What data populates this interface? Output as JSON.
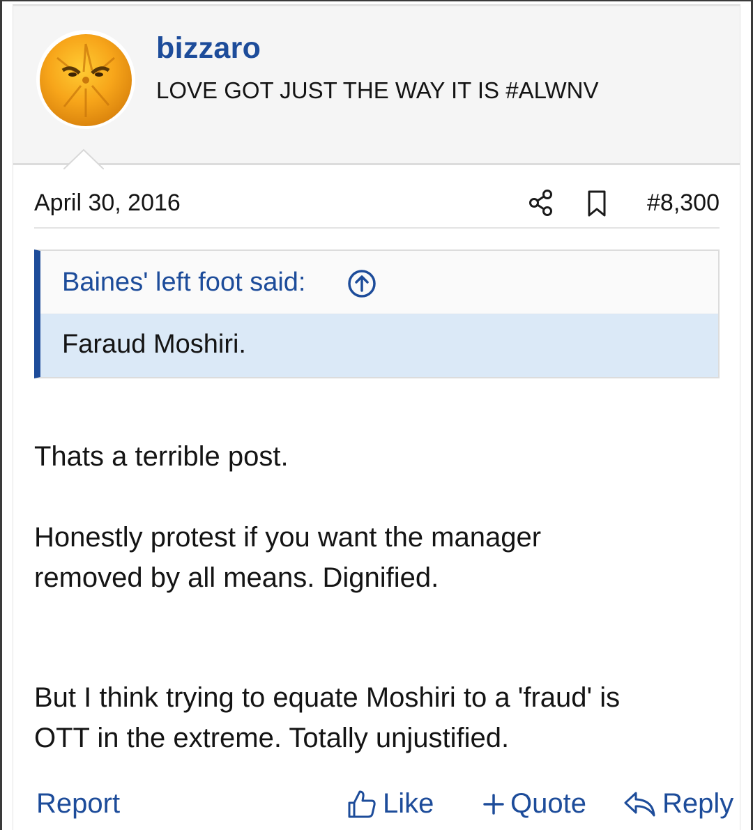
{
  "user": {
    "name": "bizzaro",
    "title": "LOVE GOT JUST THE WAY IT IS #ALWNV",
    "avatar_icon": "angry-orange-avatar"
  },
  "post": {
    "date": "April 30, 2016",
    "number": "#8,300",
    "share_icon": "share-icon",
    "bookmark_icon": "bookmark-icon"
  },
  "quote": {
    "author_line": "Baines' left foot said:",
    "text": "Faraud Moshiri.",
    "jump_icon": "arrow-up-circle-icon"
  },
  "message": {
    "p1": "Thats a terrible post.",
    "p2_line1": "Honestly protest if you want the manager",
    "p2_line2": "removed by all means. Dignified.",
    "p3_line1": "But I think trying to equate Moshiri to a 'fraud' is",
    "p3_line2": "OTT in the extreme. Totally unjustified."
  },
  "actions": {
    "report": "Report",
    "like": "Like",
    "quote": "Quote",
    "reply": "Reply"
  },
  "colors": {
    "link": "#1d4c9a",
    "quote_bar": "#1d4c9a",
    "quote_body_bg": "#dbe9f7",
    "header_bg": "#f5f5f5"
  }
}
